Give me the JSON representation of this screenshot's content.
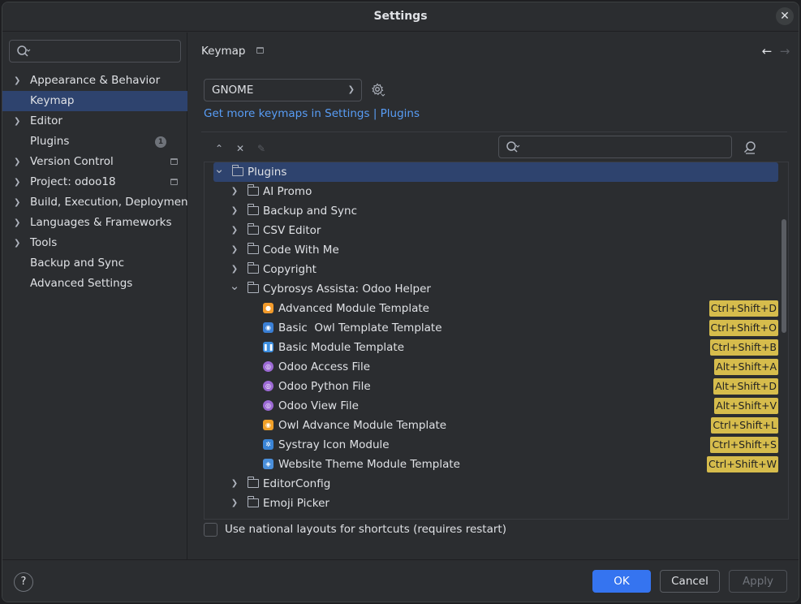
{
  "window": {
    "title": "Settings"
  },
  "sidebar": {
    "items": [
      {
        "label": "Appearance & Behavior",
        "expandable": true
      },
      {
        "label": "Keymap",
        "selected": true
      },
      {
        "label": "Editor",
        "expandable": true
      },
      {
        "label": "Plugins",
        "badge": "1"
      },
      {
        "label": "Version Control",
        "expandable": true
      },
      {
        "label": "Project: odoo18",
        "expandable": true
      },
      {
        "label": "Build, Execution, Deployment",
        "expandable": true
      },
      {
        "label": "Languages & Frameworks",
        "expandable": true
      },
      {
        "label": "Tools",
        "expandable": true
      },
      {
        "label": "Backup and Sync"
      },
      {
        "label": "Advanced Settings"
      }
    ]
  },
  "main": {
    "breadcrumb": "Keymap",
    "keymap_select": "GNOME",
    "more_link": "Get more keymaps in Settings | Plugins",
    "tree": [
      {
        "label": "Plugins",
        "level": 0,
        "expanded": true,
        "folder": true
      },
      {
        "label": "AI Promo",
        "level": 1,
        "folder": true
      },
      {
        "label": "Backup and Sync",
        "level": 1,
        "folder": true
      },
      {
        "label": "CSV Editor",
        "level": 1,
        "folder": true
      },
      {
        "label": "Code With Me",
        "level": 1,
        "folder": true
      },
      {
        "label": "Copyright",
        "level": 1,
        "folder": true
      },
      {
        "label": "Cybrosys Assista: Odoo Helper",
        "level": 1,
        "folder": true,
        "expanded": true
      },
      {
        "label": "Advanced Module Template",
        "level": 2,
        "shortcut": "Ctrl+Shift+D",
        "icon": "orange"
      },
      {
        "label": "Basic  Owl Template Template",
        "level": 2,
        "shortcut": "Ctrl+Shift+O",
        "icon": "blue-owl"
      },
      {
        "label": "Basic Module Template",
        "level": 2,
        "shortcut": "Ctrl+Shift+B",
        "icon": "blue-pause"
      },
      {
        "label": "Odoo Access File",
        "level": 2,
        "shortcut": "Alt+Shift+A",
        "icon": "purple-circle"
      },
      {
        "label": "Odoo Python File",
        "level": 2,
        "shortcut": "Alt+Shift+D",
        "icon": "purple-circle"
      },
      {
        "label": "Odoo View File",
        "level": 2,
        "shortcut": "Alt+Shift+V",
        "icon": "purple-circle"
      },
      {
        "label": "Owl Advance Module Template",
        "level": 2,
        "shortcut": "Ctrl+Shift+L",
        "icon": "orange-owl"
      },
      {
        "label": "Systray Icon Module",
        "level": 2,
        "shortcut": "Ctrl+Shift+S",
        "icon": "blue-gear"
      },
      {
        "label": "Website Theme Module Template",
        "level": 2,
        "shortcut": "Ctrl+Shift+W",
        "icon": "blue-web"
      },
      {
        "label": "EditorConfig",
        "level": 1,
        "folder": true
      },
      {
        "label": "Emoji Picker",
        "level": 1,
        "folder": true
      }
    ],
    "national_layouts_label": "Use national layouts for shortcuts (requires restart)",
    "national_layouts_checked": false
  },
  "footer": {
    "help": "?",
    "ok": "OK",
    "cancel": "Cancel",
    "apply": "Apply"
  },
  "colors": {
    "accent": "#3574f0",
    "selection": "#2e436e",
    "link": "#589df6",
    "shortcut_highlight": "#d6bc4c"
  }
}
